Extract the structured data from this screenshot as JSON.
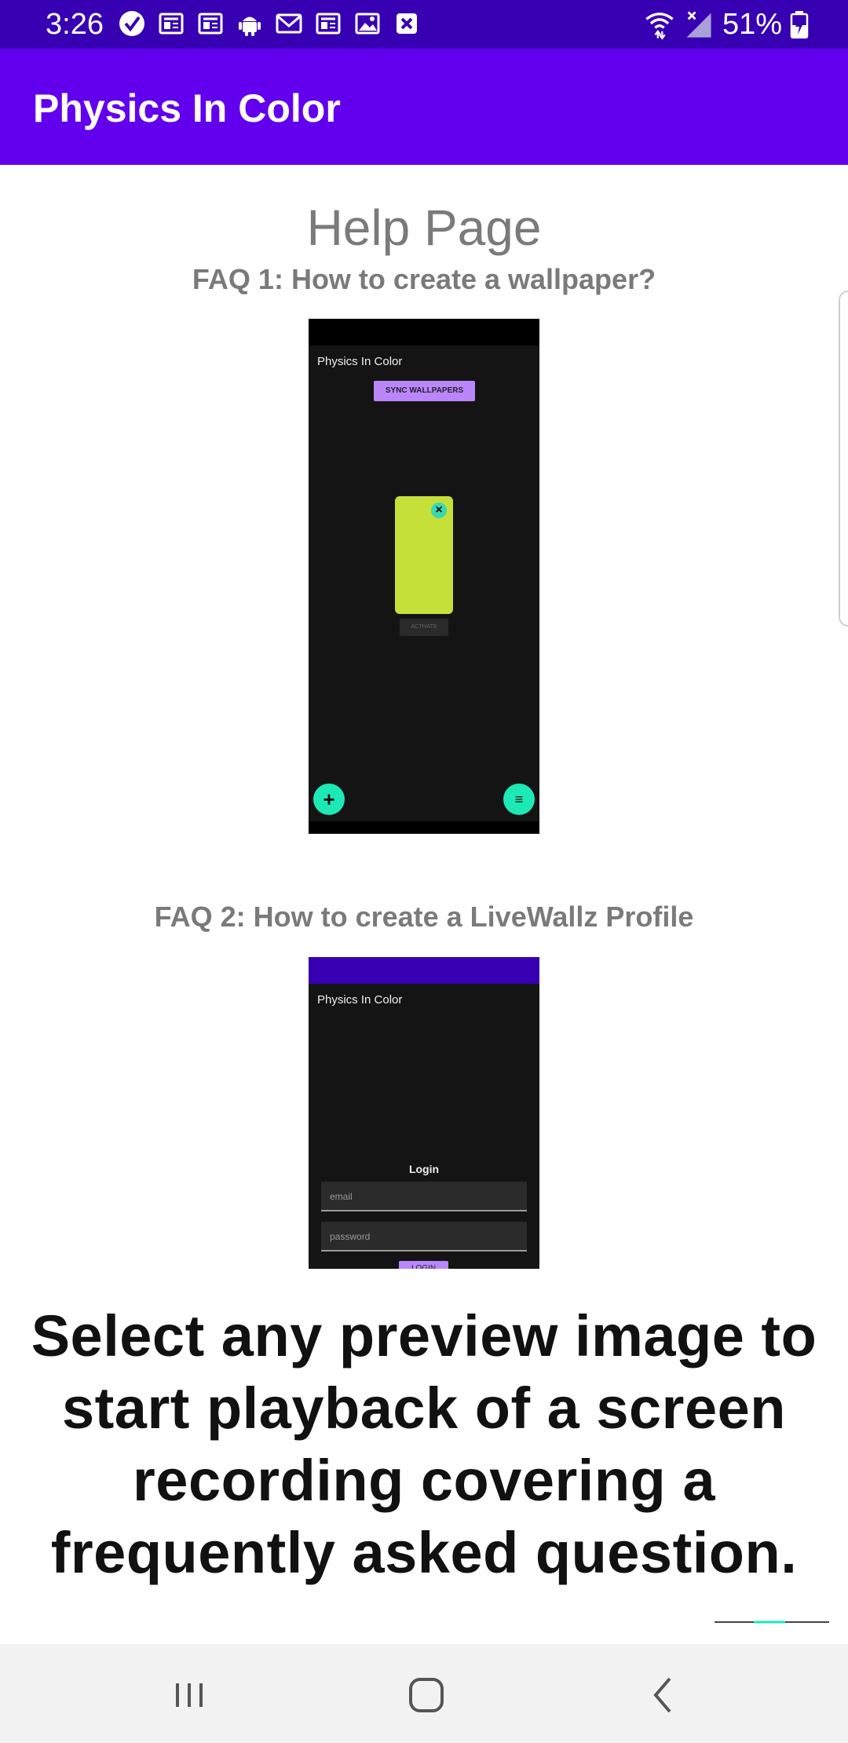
{
  "status_bar": {
    "time": "3:26",
    "battery": "51%",
    "notification_icons": [
      "check-circle-icon",
      "news-icon",
      "news-icon",
      "android-icon",
      "gmail-icon",
      "news-icon",
      "image-icon",
      "close-square-icon"
    ]
  },
  "app_bar": {
    "title": "Physics In Color"
  },
  "help": {
    "title": "Help Page"
  },
  "faqs": [
    {
      "question": "FAQ 1: How to create a wallpaper?",
      "preview": {
        "app_title": "Physics In Color",
        "sync_label": "SYNC WALLPAPERS",
        "activate_label": "ACTIVATE",
        "card_color": "#c6e03a"
      }
    },
    {
      "question": "FAQ 2: How to create a LiveWallz Profile",
      "preview": {
        "app_title": "Physics In Color",
        "login_label": "Login",
        "email_placeholder": "email",
        "password_placeholder": "password",
        "login_button": "LOGIN"
      }
    }
  ],
  "overlay": {
    "lines": [
      "Select any preview image to",
      "start playback of a screen",
      "recording covering a",
      "frequently asked question."
    ]
  },
  "colors": {
    "status_bar": "#3700b3",
    "app_bar": "#6200ee",
    "accent_teal": "#1de9b6",
    "accent_purple": "#bb86fc"
  },
  "nav_bar": {
    "buttons": [
      "recents-icon",
      "home-icon",
      "back-icon"
    ]
  }
}
